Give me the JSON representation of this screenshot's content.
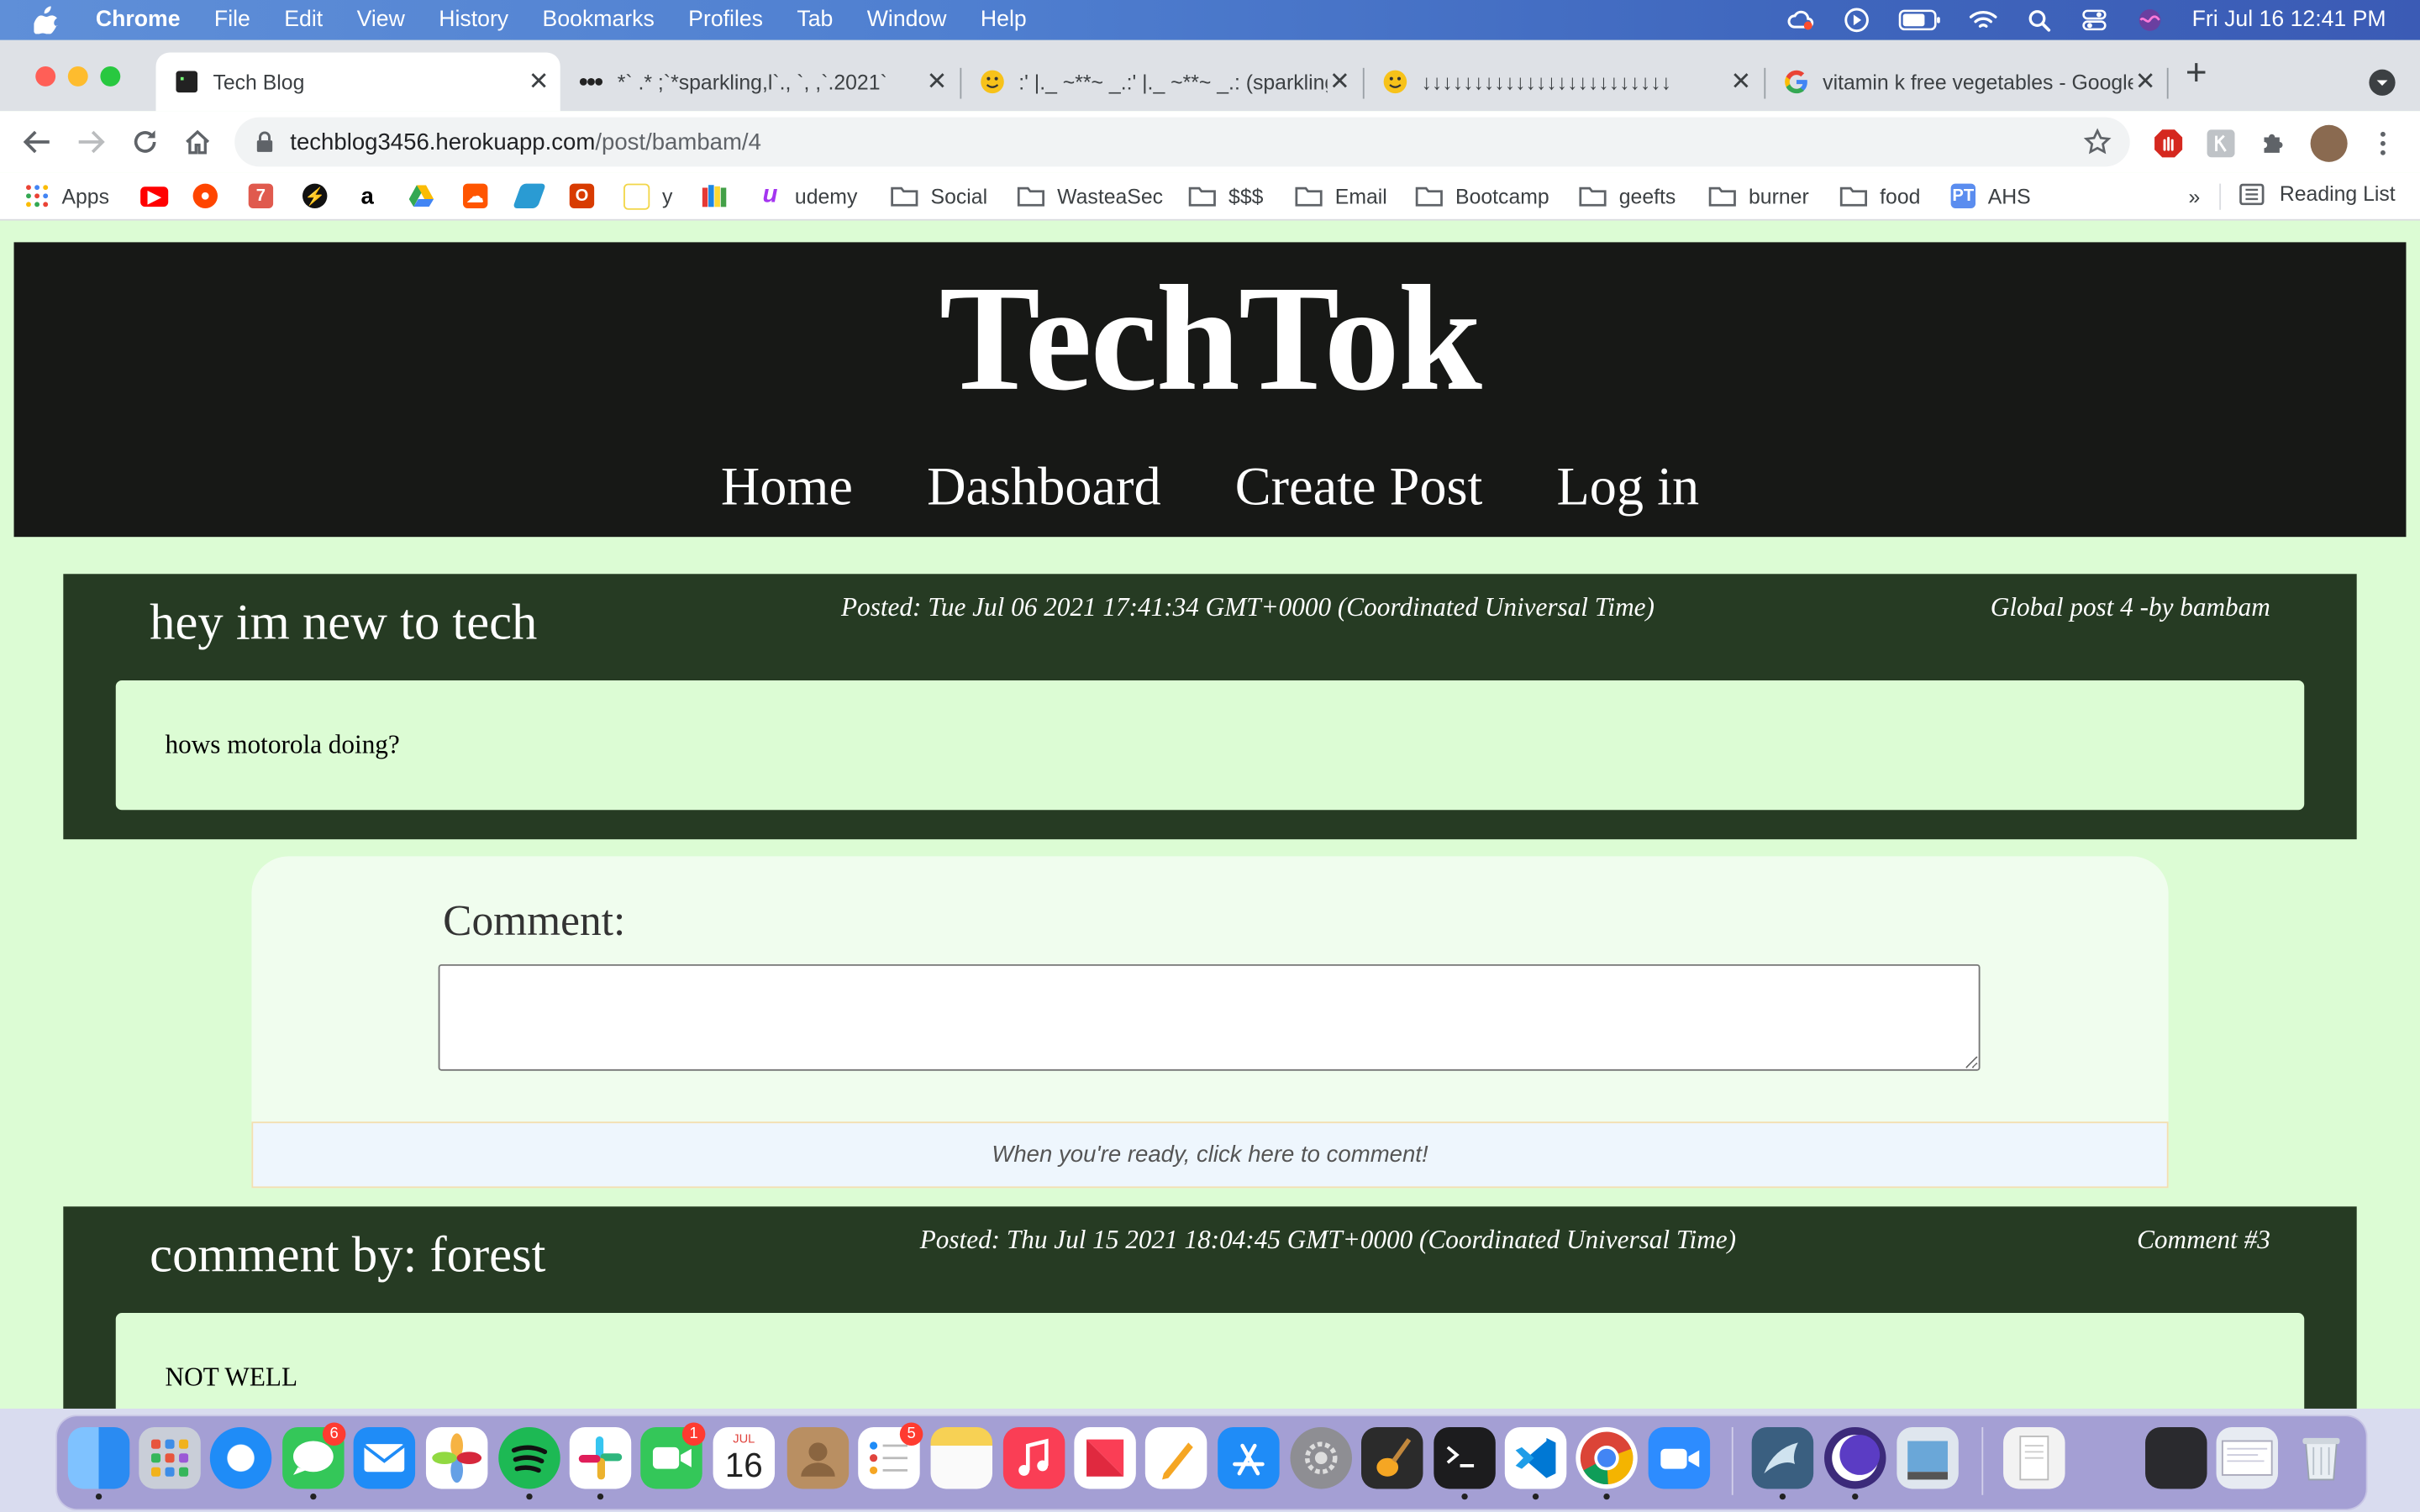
{
  "menubar": {
    "app_name": "Chrome",
    "menus": [
      "File",
      "Edit",
      "View",
      "History",
      "Bookmarks",
      "Profiles",
      "Tab",
      "Window",
      "Help"
    ],
    "clock": "Fri Jul 16  12:41 PM"
  },
  "tabs": [
    {
      "title": "Tech Blog",
      "active": true
    },
    {
      "title": "*` .* ;`*sparkling,l`., `, ,`.2021` ",
      "active": false
    },
    {
      "title": ":' |._ ~**~ _.:' |._ ~**~ _.: (sparkling)",
      "active": false
    },
    {
      "title": "↓↓↓↓↓↓↓↓↓↓↓↓↓↓↓↓↓↓↓↓↓↓↓↓",
      "active": false
    },
    {
      "title": "vitamin k free vegetables - Google Search",
      "active": false
    }
  ],
  "omnibox": {
    "url_host": "techblog3456.herokuapp.com",
    "url_path": "/post/bambam/4"
  },
  "bookmarks": {
    "apps_label": "Apps",
    "y_label": "y",
    "udemy_label": "udemy",
    "folders": [
      "Social",
      "WasteaSec",
      "$$$",
      "Email",
      "Bootcamp",
      "geefts",
      "burner",
      "food"
    ],
    "ahs_label": "AHS",
    "more": "»",
    "reading_list": "Reading List"
  },
  "site": {
    "title": "TechTok",
    "nav": [
      "Home",
      "Dashboard",
      "Create Post",
      "Log in"
    ]
  },
  "post": {
    "title": "hey im new to tech",
    "date": "Posted: Tue Jul 06 2021 17:41:34 GMT+0000 (Coordinated Universal Time)",
    "meta": "Global post 4 -by bambam",
    "body": "hows motorola doing?"
  },
  "comment_form": {
    "label": "Comment:",
    "input_value": "",
    "submit_text": "When you're ready, click here to comment!"
  },
  "comments": [
    {
      "title": "comment by: forest",
      "date": "Posted: Thu Jul 15 2021 18:04:45 GMT+0000 (Coordinated Universal Time)",
      "meta": "Comment #3",
      "body": "NOT WELL"
    }
  ],
  "dock": {
    "badges": {
      "messages": "6",
      "facetime": "1",
      "reminders": "5"
    },
    "calendar_month": "JUL",
    "calendar_day": "16"
  },
  "colors": {
    "page_bg": "#dcfcd4",
    "header_bg": "#171816",
    "post_bg": "#263b23"
  }
}
